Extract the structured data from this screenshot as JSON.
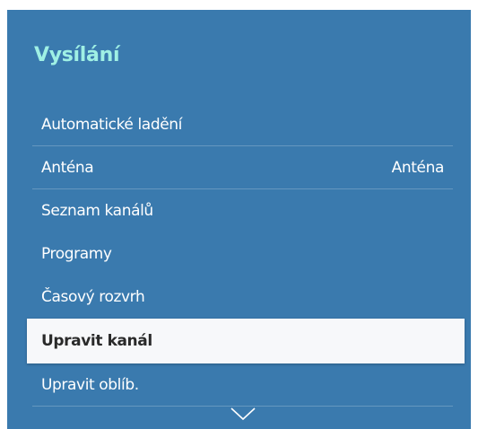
{
  "menu": {
    "title": "Vysílání",
    "items": [
      {
        "label": "Automatické ladění",
        "value": ""
      },
      {
        "label": "Anténa",
        "value": "Anténa"
      },
      {
        "label": "Seznam kanálů",
        "value": ""
      },
      {
        "label": "Programy",
        "value": ""
      },
      {
        "label": "Časový rozvrh",
        "value": ""
      },
      {
        "label": "Upravit kanál",
        "value": "",
        "selected": true
      },
      {
        "label": "Upravit oblíb.",
        "value": ""
      }
    ]
  },
  "colors": {
    "panel_background": "#3a7aae",
    "title": "#9ff0e4",
    "selected_background": "#f7f8fa"
  },
  "icons": {
    "scroll_down": "chevron-down-icon"
  }
}
